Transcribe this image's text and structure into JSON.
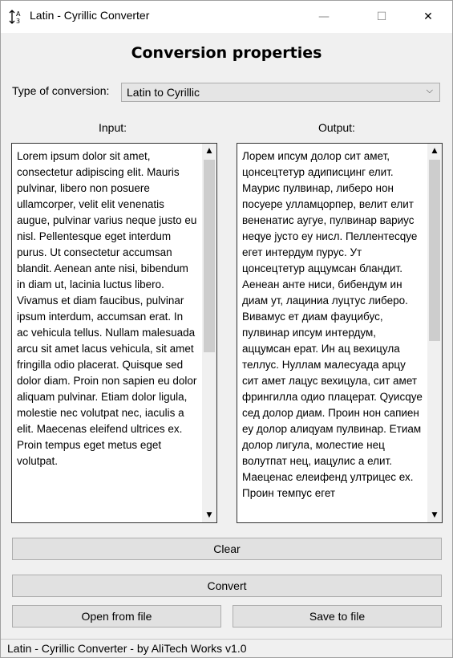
{
  "window": {
    "title": "Latin - Cyrillic Converter",
    "icon_glyph": "↕",
    "minimize_glyph": "—",
    "maximize_glyph": "☐",
    "close_glyph": "✕"
  },
  "heading": "Conversion properties",
  "conversion": {
    "label": "Type of conversion:",
    "selected": "Latin to Cyrillic"
  },
  "input": {
    "label": "Input:",
    "text": "Lorem ipsum dolor sit amet, consectetur adipiscing elit. Mauris pulvinar, libero non posuere ullamcorper, velit elit venenatis augue, pulvinar varius neque justo eu nisl. Pellentesque eget interdum purus. Ut consectetur accumsan blandit. Aenean ante nisi, bibendum in diam ut, lacinia luctus libero. Vivamus et diam faucibus, pulvinar ipsum interdum, accumsan erat. In ac vehicula tellus. Nullam malesuada arcu sit amet lacus vehicula, sit amet fringilla odio placerat. Quisque sed dolor diam. Proin non sapien eu dolor aliquam pulvinar. Etiam dolor ligula, molestie nec volutpat nec, iaculis a elit. Maecenas eleifend ultrices ex. Proin tempus eget metus eget volutpat."
  },
  "output": {
    "label": "Output:",
    "text": "Лорем ипсум долор сит амет, цонсецтетур адиписцинг елит. Маурис пулвинар, либеро нон посуере улламцорпер, велит елит вененатис аугуе, пулвинар вариус неqуе јусто еу нисл. Пеллентесqуе егет интердум пурус. Ут цонсецтетур аццумсан бландит. Аенеан анте ниси, бибендум ин диам ут, лациниа луцтус либеро. Вивамус ет диам фауцибус, пулвинар ипсум интердум, аццумсан ерат. Ин ац вехицула теллус. Нуллам малесуада арцу сит амет лацус вехицула, сит амет фрингилла одио плацерат. Qуисqуе сед долор диам. Проин нон сапиен еу долор алиqуам пулвинар. Етиам долор лигула, молестие нец волутпат нец, иацулис а елит. Маеценас елеифенд ултрицес ех. Проин темпус егет"
  },
  "buttons": {
    "clear": "Clear",
    "convert": "Convert",
    "open": "Open from file",
    "save": "Save to file"
  },
  "status": "Latin - Cyrillic Converter - by AliTech Works v1.0"
}
